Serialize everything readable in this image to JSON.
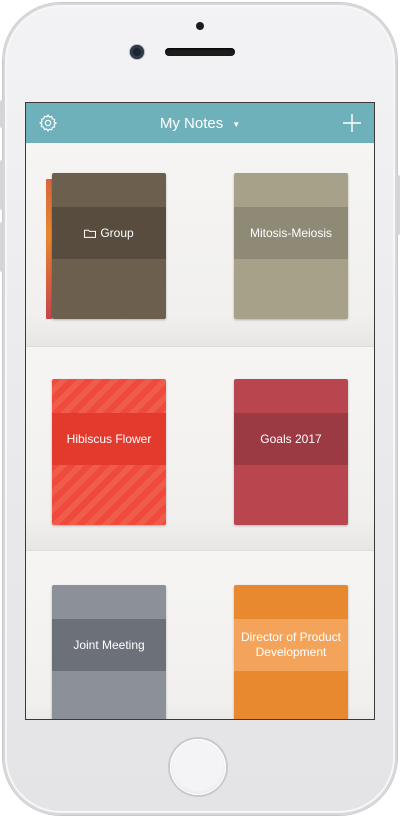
{
  "navbar": {
    "title": "My Notes",
    "settings_icon": "gear-icon",
    "add_icon": "plus-icon",
    "dropdown_icon": "caret-down-icon",
    "background": "#6fb1bb"
  },
  "notebooks": [
    {
      "label": "Group",
      "type": "folder",
      "icon": "folder-icon",
      "color": "#6c5f4d",
      "band": "#574c3e"
    },
    {
      "label": "Mitosis-Meiosis",
      "type": "notebook",
      "color": "#a8a18a",
      "band": "#8f8a76"
    },
    {
      "label": "Hibiscus Flower",
      "type": "notebook",
      "color": "#ef4a3b",
      "band": "#e33a2e"
    },
    {
      "label": "Goals 2017",
      "type": "notebook",
      "color": "#b9464f",
      "band": "#9c3a43"
    },
    {
      "label": "Joint Meeting",
      "type": "notebook",
      "color": "#8b9099",
      "band": "#6c7079"
    },
    {
      "label": "Director of Product Development",
      "type": "notebook",
      "color": "#e8882f",
      "band": "#f3a45a"
    }
  ]
}
